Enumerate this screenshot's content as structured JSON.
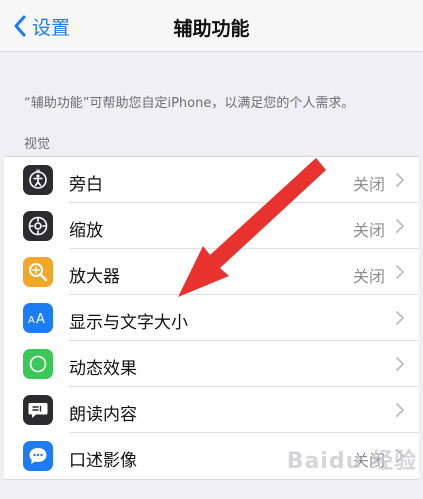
{
  "navbar": {
    "back_label": "设置",
    "title": "辅助功能"
  },
  "description": "“辅助功能”可帮助您自定iPhone，以满足您的个人需求。",
  "section": {
    "header": "视觉",
    "items": [
      {
        "label": "旁白",
        "value": "关闭",
        "icon": "voiceover-icon",
        "icon_bg": "#2c2c2e"
      },
      {
        "label": "缩放",
        "value": "关闭",
        "icon": "zoom-icon",
        "icon_bg": "#2c2c2e"
      },
      {
        "label": "放大器",
        "value": "关闭",
        "icon": "magnifier-icon",
        "icon_bg": "#f0a72a"
      },
      {
        "label": "显示与文字大小",
        "value": "",
        "icon": "text-size-icon",
        "icon_bg": "#1e7cf2"
      },
      {
        "label": "动态效果",
        "value": "",
        "icon": "motion-icon",
        "icon_bg": "#3cc75a"
      },
      {
        "label": "朗读内容",
        "value": "",
        "icon": "spoken-content-icon",
        "icon_bg": "#2c2c2e"
      },
      {
        "label": "口述影像",
        "value": "关闭",
        "icon": "audio-description-icon",
        "icon_bg": "#1e7cf2"
      }
    ]
  },
  "colors": {
    "accent": "#1a7cf4",
    "annotation_arrow": "#e8322e"
  },
  "watermark": "Baidu 经验"
}
